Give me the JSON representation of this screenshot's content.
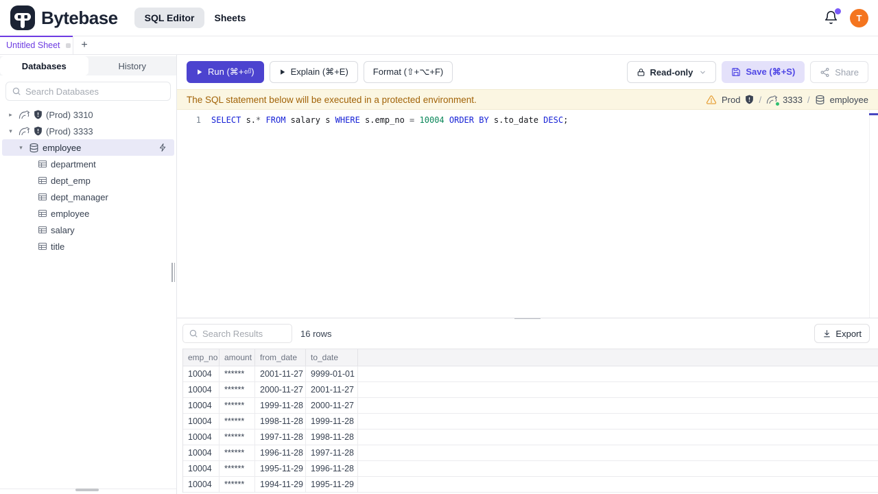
{
  "colors": {
    "accent": "#4c43cf",
    "tab_purple": "#6d3be2",
    "banner_bg": "#fbf6e2",
    "banner_text": "#a16207",
    "avatar_bg": "#f4751f",
    "keyword": "#1621d6",
    "number": "#098658",
    "selected_row_bg": "#e9e9f7"
  },
  "header": {
    "brand": "Bytebase",
    "nav_sql_editor": "SQL Editor",
    "nav_sheets": "Sheets",
    "avatar_letter": "T"
  },
  "sheet_tabs": {
    "active": "Untitled Sheet",
    "add": "+"
  },
  "sidebar": {
    "tab_databases": "Databases",
    "tab_history": "History",
    "search_placeholder": "Search Databases",
    "instances": [
      {
        "label": "(Prod) 3310",
        "expanded": false
      },
      {
        "label": "(Prod) 3333",
        "expanded": true
      }
    ],
    "database": "employee",
    "tables": [
      "department",
      "dept_emp",
      "dept_manager",
      "employee",
      "salary",
      "title"
    ]
  },
  "toolbar": {
    "run": "Run (⌘+⏎)",
    "explain": "Explain (⌘+E)",
    "format": "Format (⇧+⌥+F)",
    "readonly": "Read-only",
    "save": "Save (⌘+S)",
    "share": "Share"
  },
  "banner": {
    "message": "The SQL statement below will be executed in a protected environment.",
    "environment": "Prod",
    "separator": "/",
    "instance": "3333",
    "database": "employee"
  },
  "editor": {
    "line_number": "1",
    "tokens": [
      {
        "text": "SELECT",
        "type": "keyword"
      },
      {
        "text": " s.",
        "type": "plain"
      },
      {
        "text": "*",
        "type": "operator"
      },
      {
        "text": " ",
        "type": "plain"
      },
      {
        "text": "FROM",
        "type": "keyword"
      },
      {
        "text": " salary s ",
        "type": "plain"
      },
      {
        "text": "WHERE",
        "type": "keyword"
      },
      {
        "text": " s.emp_no ",
        "type": "plain"
      },
      {
        "text": "=",
        "type": "operator"
      },
      {
        "text": " ",
        "type": "plain"
      },
      {
        "text": "10004",
        "type": "number"
      },
      {
        "text": " ",
        "type": "plain"
      },
      {
        "text": "ORDER",
        "type": "keyword"
      },
      {
        "text": " ",
        "type": "plain"
      },
      {
        "text": "BY",
        "type": "keyword"
      },
      {
        "text": " s.to_date ",
        "type": "plain"
      },
      {
        "text": "DESC",
        "type": "keyword"
      },
      {
        "text": ";",
        "type": "plain"
      }
    ]
  },
  "results": {
    "search_placeholder": "Search Results",
    "row_count_label": "16 rows",
    "export_label": "Export",
    "columns": [
      "emp_no",
      "amount",
      "from_date",
      "to_date"
    ],
    "rows": [
      [
        "10004",
        "******",
        "2001-11-27",
        "9999-01-01"
      ],
      [
        "10004",
        "******",
        "2000-11-27",
        "2001-11-27"
      ],
      [
        "10004",
        "******",
        "1999-11-28",
        "2000-11-27"
      ],
      [
        "10004",
        "******",
        "1998-11-28",
        "1999-11-28"
      ],
      [
        "10004",
        "******",
        "1997-11-28",
        "1998-11-28"
      ],
      [
        "10004",
        "******",
        "1996-11-28",
        "1997-11-28"
      ],
      [
        "10004",
        "******",
        "1995-11-29",
        "1996-11-28"
      ],
      [
        "10004",
        "******",
        "1994-11-29",
        "1995-11-29"
      ]
    ]
  }
}
